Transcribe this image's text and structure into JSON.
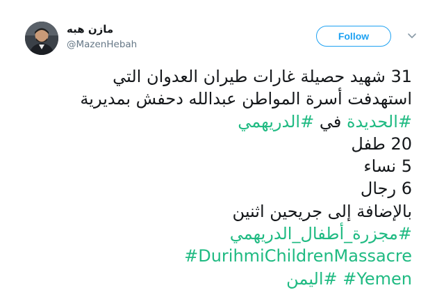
{
  "user": {
    "display_name": "مازن هبه",
    "handle": "@MazenHebah",
    "avatar_icon": "profile-photo"
  },
  "actions": {
    "follow_label": "Follow",
    "menu_icon": "chevron-down-icon"
  },
  "colors": {
    "hashtag": "#1fba82",
    "follow_accent": "#1da1f2",
    "text": "#14171a",
    "secondary_text": "#657786"
  },
  "tweet": {
    "line1": "31 شهيد حصيلة غارات طيران العدوان التي",
    "line2": "استهدفت أسرة المواطن عبدالله دحفش بمديرية",
    "line3_tag1": "#الدريهمي",
    "line3_word": "في",
    "line3_tag2": "#الحديدة",
    "line4": "20 طفل",
    "line5": "5 نساء",
    "line6": "6 رجال",
    "line7": "بالإضافة إلى جريحين اثنين",
    "tag_massacre_ar": "#مجزرة_أطفال_الدريهمي",
    "tag_massacre_en": "#DurihmiChildrenMassacre",
    "tag_yemen_ar": "#اليمن",
    "tag_yemen_en": "#Yemen"
  }
}
